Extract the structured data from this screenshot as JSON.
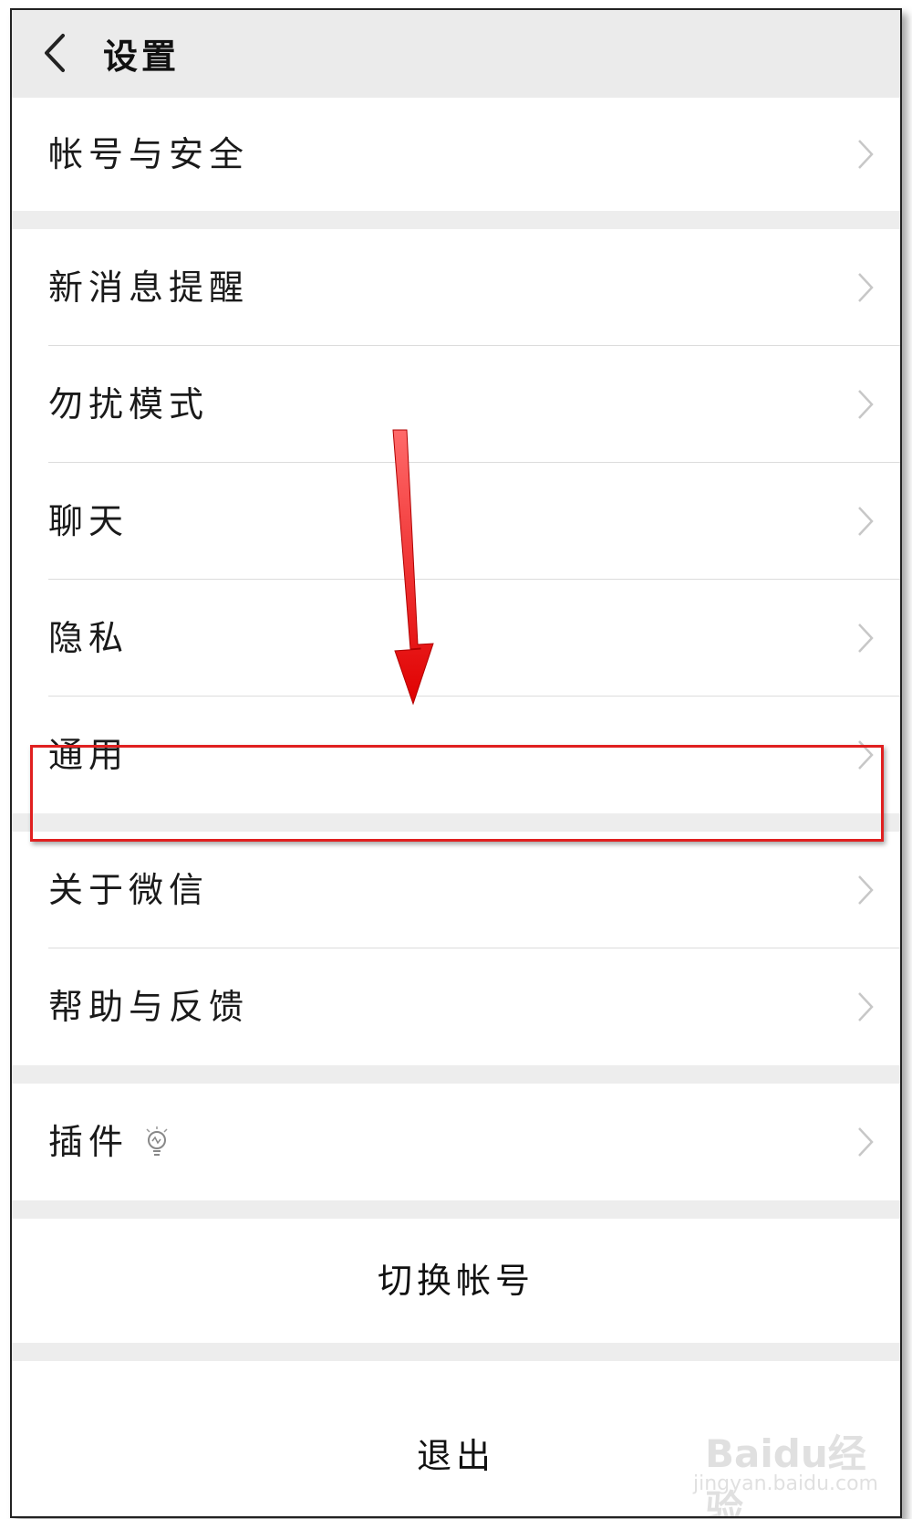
{
  "header": {
    "title": "设置",
    "back_icon": "chevron-left-icon"
  },
  "groups": [
    {
      "items": [
        {
          "label": "帐号与安全"
        }
      ]
    },
    {
      "items": [
        {
          "label": "新消息提醒"
        },
        {
          "label": "勿扰模式"
        },
        {
          "label": "聊天"
        },
        {
          "label": "隐私"
        },
        {
          "label": "通用"
        }
      ]
    },
    {
      "items": [
        {
          "label": "关于微信"
        },
        {
          "label": "帮助与反馈"
        }
      ]
    },
    {
      "items": [
        {
          "label": "插件",
          "badge_icon": "lightbulb-icon"
        }
      ]
    }
  ],
  "actions": {
    "switch_account": "切换帐号",
    "logout": "退出"
  },
  "annotation": {
    "highlight_color": "#e02020",
    "highlighted_item": "通用"
  },
  "watermark": {
    "brand": "Baidu经验",
    "url": "jingyan.baidu.com"
  }
}
